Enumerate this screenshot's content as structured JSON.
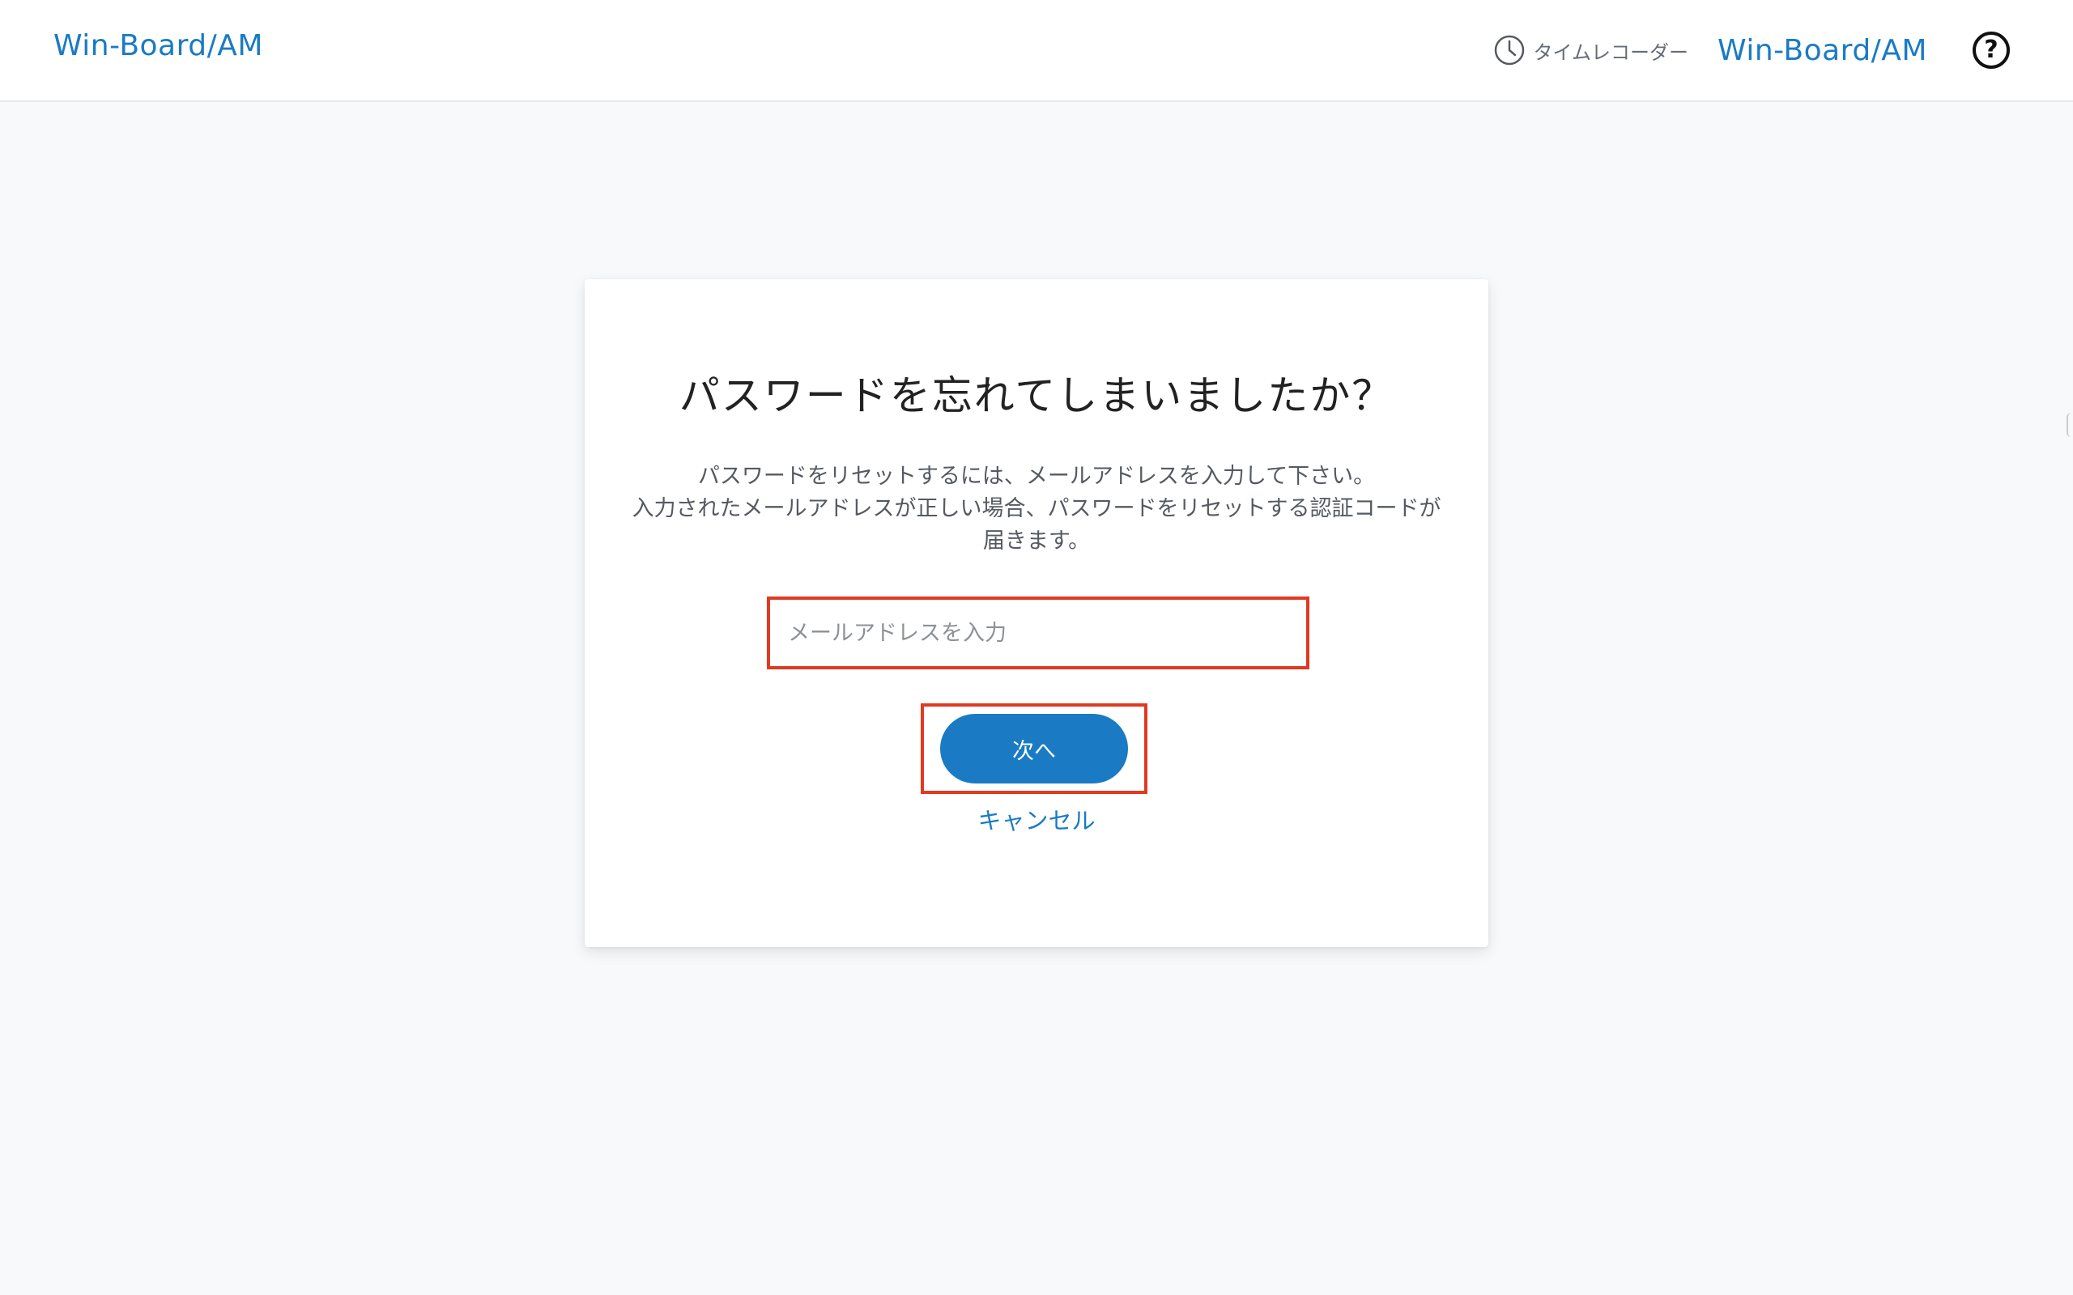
{
  "header": {
    "brand_left": "Win-Board/AM",
    "time_recorder_label": "タイムレコーダー",
    "brand_right": "Win-Board/AM",
    "help_symbol": "?"
  },
  "card": {
    "title": "パスワードを忘れてしまいましたか？",
    "description_lines": [
      "パスワードをリセットするには、メールアドレスを入力して下さい。",
      "入力されたメールアドレスが正しい場合、パスワードをリセットする認証コードが",
      "届きます。"
    ],
    "email": {
      "value": "",
      "placeholder": "メールアドレスを入力"
    },
    "next_label": "次へ",
    "cancel_label": "キャンセル"
  },
  "colors": {
    "brand_blue": "#1a7bc4",
    "highlight_red": "#e03a22",
    "page_background": "#f8f9fb"
  },
  "icons": {
    "time_recorder": "clock-icon",
    "help": "help-icon"
  }
}
